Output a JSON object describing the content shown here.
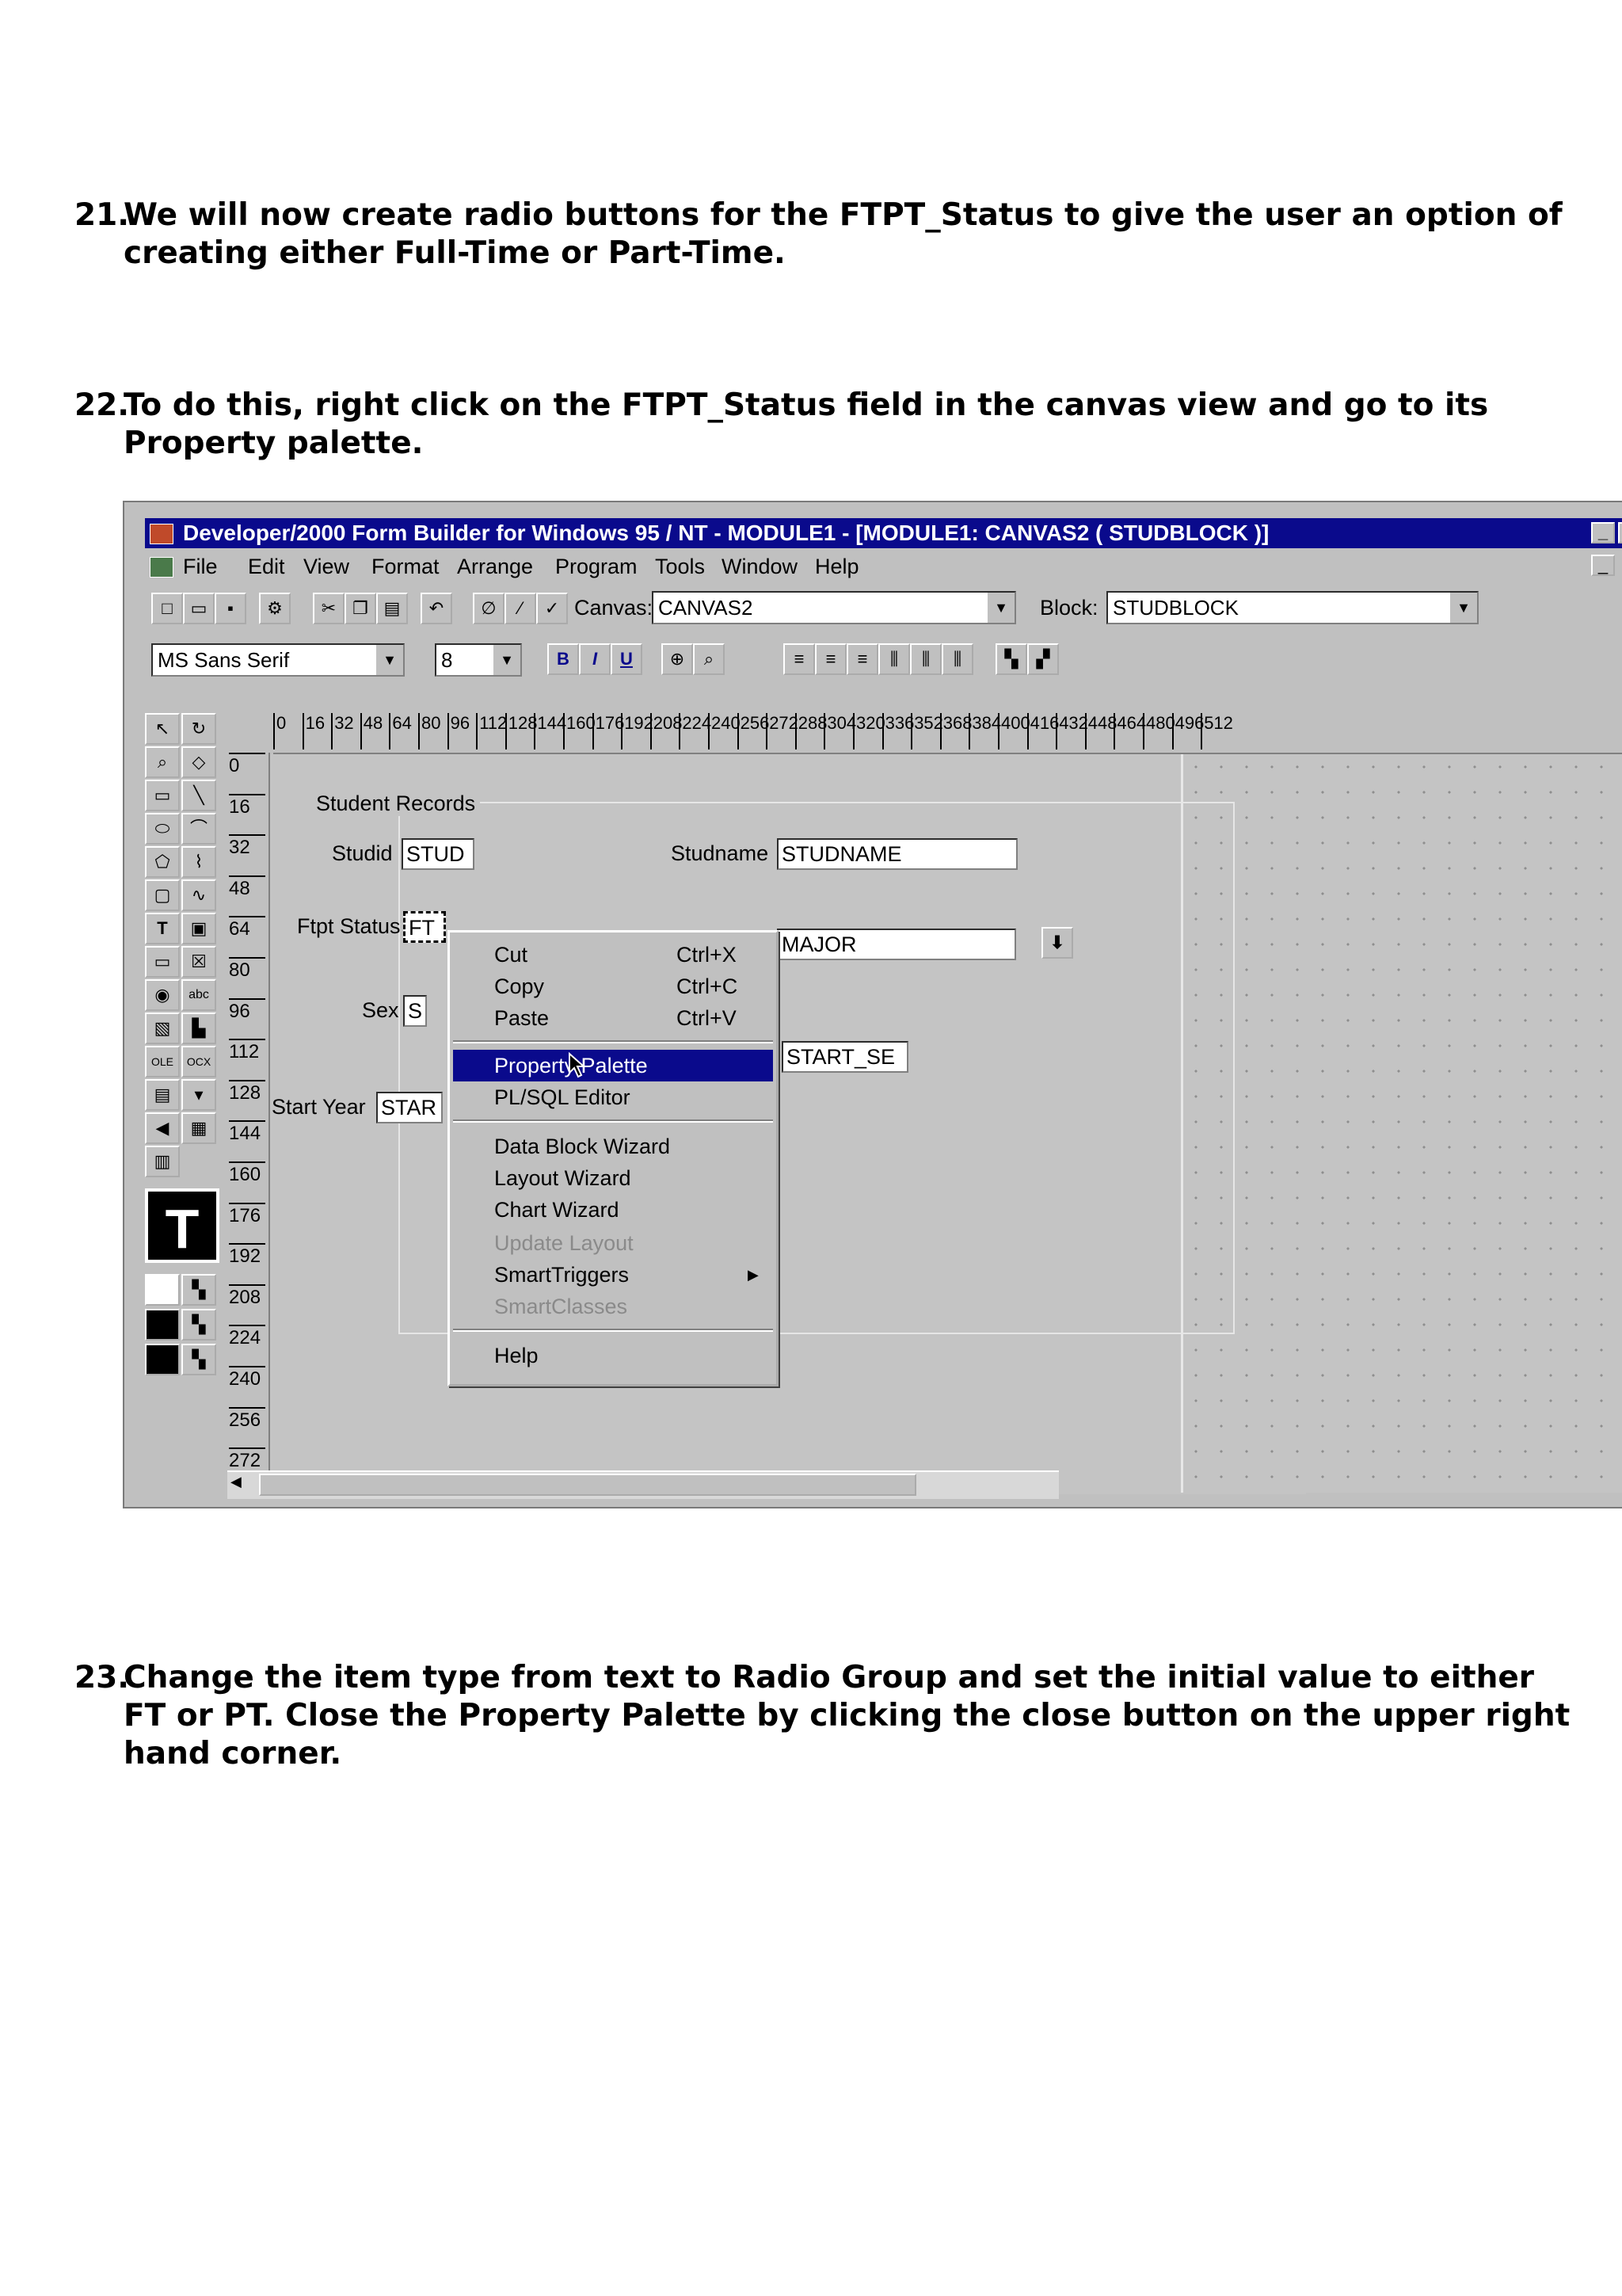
{
  "steps": [
    {
      "num": "21.",
      "text": "We will now create radio buttons for the FTPT_Status to give the user an option of creating either Full-Time or Part-Time."
    },
    {
      "num": "22.",
      "text": "To do this, right click on the FTPT_Status field in the canvas view and go to its Property palette."
    },
    {
      "num": "23.",
      "text": "Change the item type from text to Radio Group and set the initial value to either FT or PT. Close the Property Palette by clicking the close button on the upper right hand corner."
    }
  ],
  "window": {
    "title": "Developer/2000 Form Builder for Windows 95 / NT - MODULE1 - [MODULE1: CANVAS2 ( STUDBLOCK )]",
    "minimize": "_",
    "restore": "▫"
  },
  "menu": [
    "File",
    "Edit",
    "View",
    "Format",
    "Arrange",
    "Program",
    "Tools",
    "Window",
    "Help"
  ],
  "toolbar": {
    "canvas_label": "Canvas:",
    "canvas_value": "CANVAS2",
    "block_label": "Block:",
    "block_value": "STUDBLOCK",
    "font_value": "MS Sans Serif",
    "size_value": "8",
    "bold": "B",
    "italic": "I",
    "underline": "U"
  },
  "ruler": {
    "top": [
      "0",
      "16",
      "32",
      "48",
      "64",
      "80",
      "96",
      "112",
      "128",
      "144",
      "160",
      "176",
      "192",
      "208",
      "224",
      "240",
      "256",
      "272",
      "288",
      "304",
      "320",
      "336",
      "352",
      "368",
      "384",
      "400",
      "416",
      "432",
      "448",
      "464",
      "480",
      "496",
      "512"
    ],
    "left": [
      "0",
      "16",
      "32",
      "48",
      "64",
      "80",
      "96",
      "112",
      "128",
      "144",
      "160",
      "176",
      "192",
      "208",
      "224",
      "240",
      "256",
      "272"
    ]
  },
  "form": {
    "frame_title": "Student Records",
    "studid_label": "Studid",
    "studid_value": "STUD",
    "studname_label": "Studname",
    "studname_value": "STUDNAME",
    "ftpt_label": "Ftpt Status",
    "ftpt_value": "FT",
    "major_value": "MAJOR",
    "sex_label": "Sex",
    "sex_value": "S",
    "start_se_value": "START_SE",
    "start_year_label": "Start Year",
    "start_year_value": "STAR"
  },
  "context_menu": {
    "cut": "Cut",
    "cut_sc": "Ctrl+X",
    "copy": "Copy",
    "copy_sc": "Ctrl+C",
    "paste": "Paste",
    "paste_sc": "Ctrl+V",
    "property_palette": "Property Palette",
    "plsql_editor": "PL/SQL Editor",
    "data_block_wizard": "Data Block Wizard",
    "layout_wizard": "Layout Wizard",
    "chart_wizard": "Chart Wizard",
    "update_layout": "Update Layout",
    "smart_triggers": "SmartTriggers",
    "smart_classes": "SmartClasses",
    "help": "Help"
  },
  "palette_tools": [
    "T",
    "OLE",
    "OCX",
    "abc"
  ]
}
